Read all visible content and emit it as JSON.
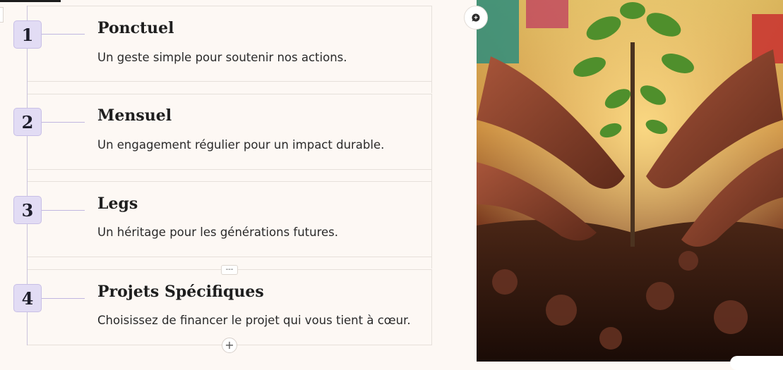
{
  "steps": [
    {
      "number": "1",
      "title": "Ponctuel",
      "description": "Un geste simple pour soutenir nos actions."
    },
    {
      "number": "2",
      "title": "Mensuel",
      "description": "Un engagement régulier pour un impact durable."
    },
    {
      "number": "3",
      "title": "Legs",
      "description": "Un héritage pour les générations futures."
    },
    {
      "number": "4",
      "title": "Projets Spécifiques",
      "description": "Choisissez de financer le projet qui vous tient à cœur."
    }
  ],
  "controls": {
    "divider_label": "---",
    "add_label": "+"
  },
  "colors": {
    "badge_bg": "#e2dcf4",
    "badge_border": "#c8bfe6",
    "page_bg": "#fdf8f4"
  },
  "icons": [
    "comment-add-icon",
    "plus-icon"
  ]
}
